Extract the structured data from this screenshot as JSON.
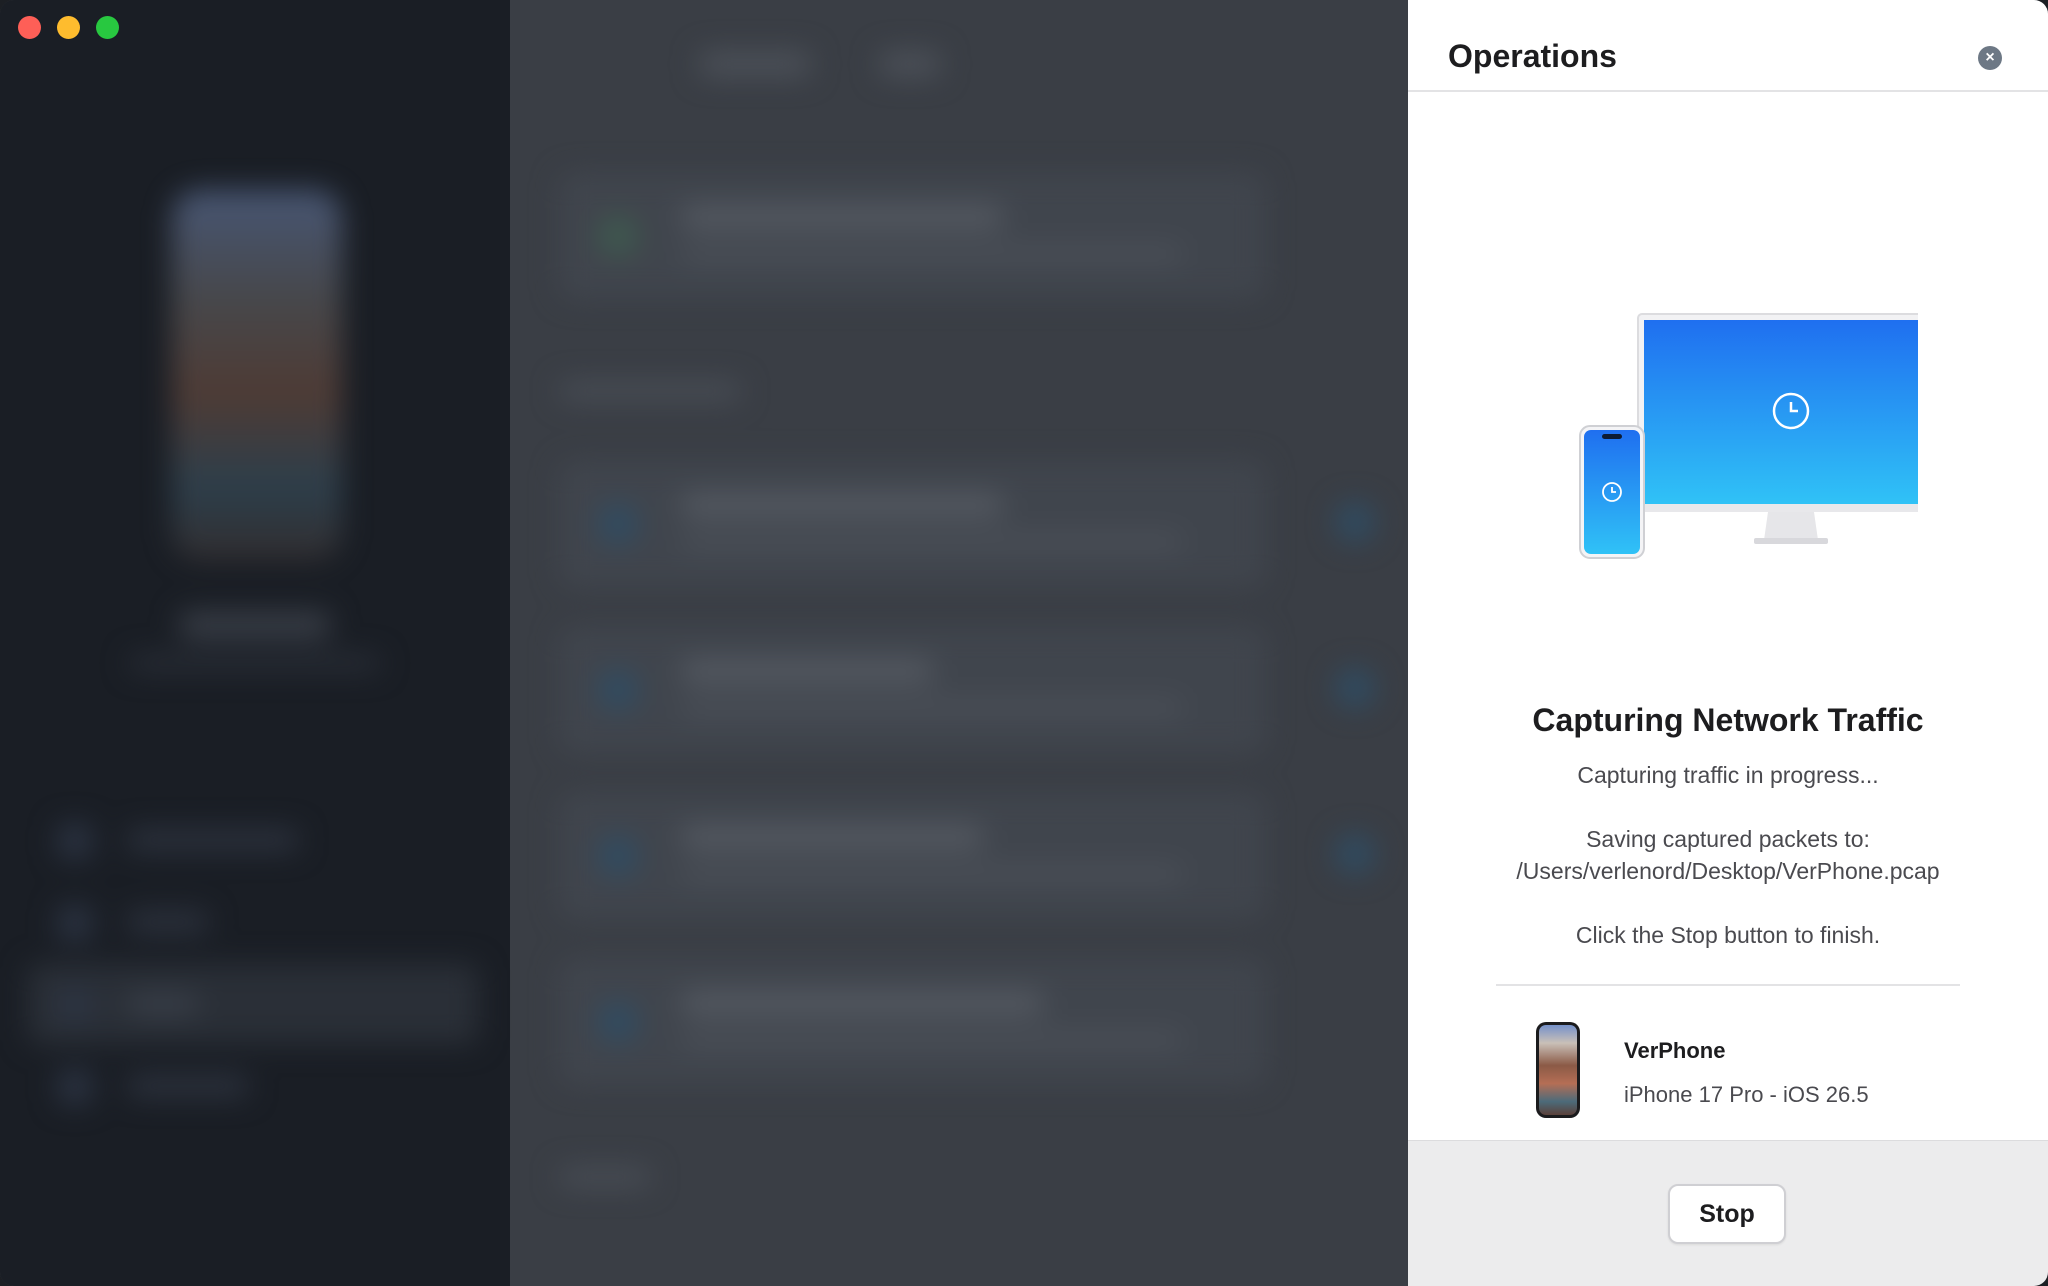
{
  "window": {
    "traffic_lights": [
      "close",
      "minimize",
      "zoom"
    ]
  },
  "panel": {
    "title": "Operations",
    "close_icon": "x-circle-icon",
    "operation": {
      "title": "Capturing Network Traffic",
      "status": "Capturing traffic in progress...",
      "saving_label": "Saving captured packets to:",
      "saving_path": "/Users/verlenord/Desktop/VerPhone.pcap",
      "instruction": "Click the Stop button to finish."
    },
    "device": {
      "name": "VerPhone",
      "model": "iPhone 17 Pro - iOS 26.5"
    },
    "stop_label": "Stop"
  },
  "colors": {
    "accent_gradient_top": "#1f73f0",
    "accent_gradient_bottom": "#2fc0f5",
    "panel_bg": "#ffffff",
    "footer_bg": "#ececed",
    "overlay_bg": "#3a3e45"
  }
}
